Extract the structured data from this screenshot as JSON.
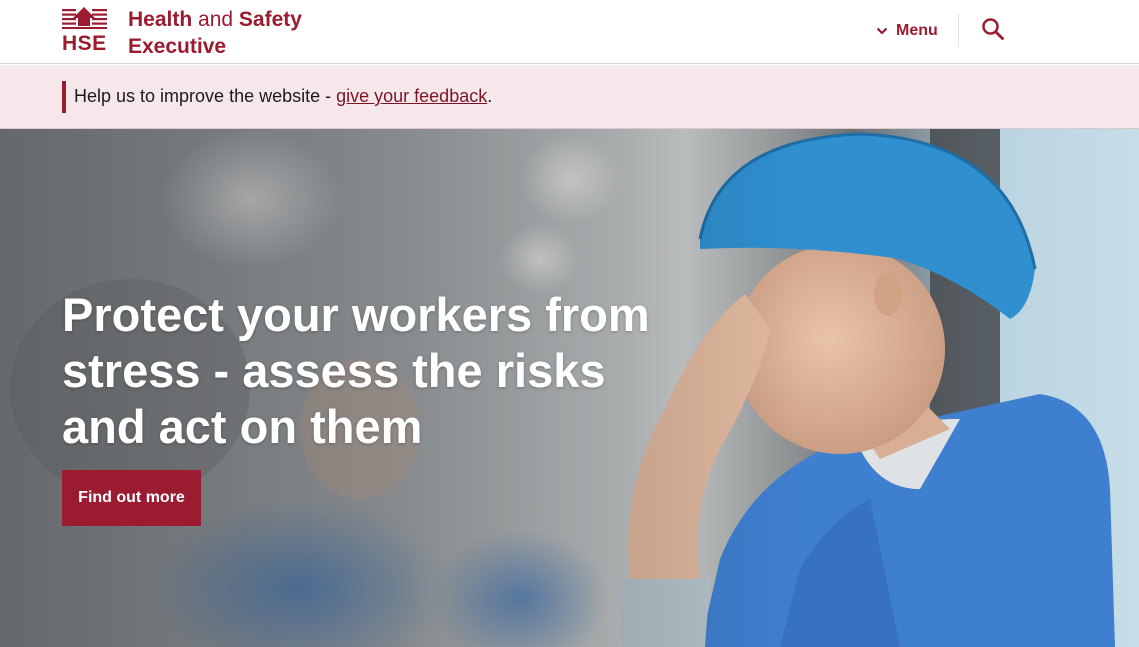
{
  "header": {
    "logo": {
      "acronym": "HSE",
      "name_line1_bold": "Health",
      "name_line1_regular": " and ",
      "name_line1_bold2": "Safety",
      "name_line2": "Executive",
      "icon": "hse-logo-mark"
    },
    "menu": {
      "label": "Menu",
      "icon": "chevron-down-icon"
    },
    "search": {
      "icon": "search-icon"
    },
    "brand_color": "#9b1b30"
  },
  "feedback": {
    "prefix": "Help us to improve the website - ",
    "link_text": "give your feedback",
    "suffix": "."
  },
  "hero": {
    "title": "Protect your workers from stress - assess the risks and act on them",
    "cta_label": "Find out more",
    "image": "healthcare-worker-stressed-photo"
  }
}
